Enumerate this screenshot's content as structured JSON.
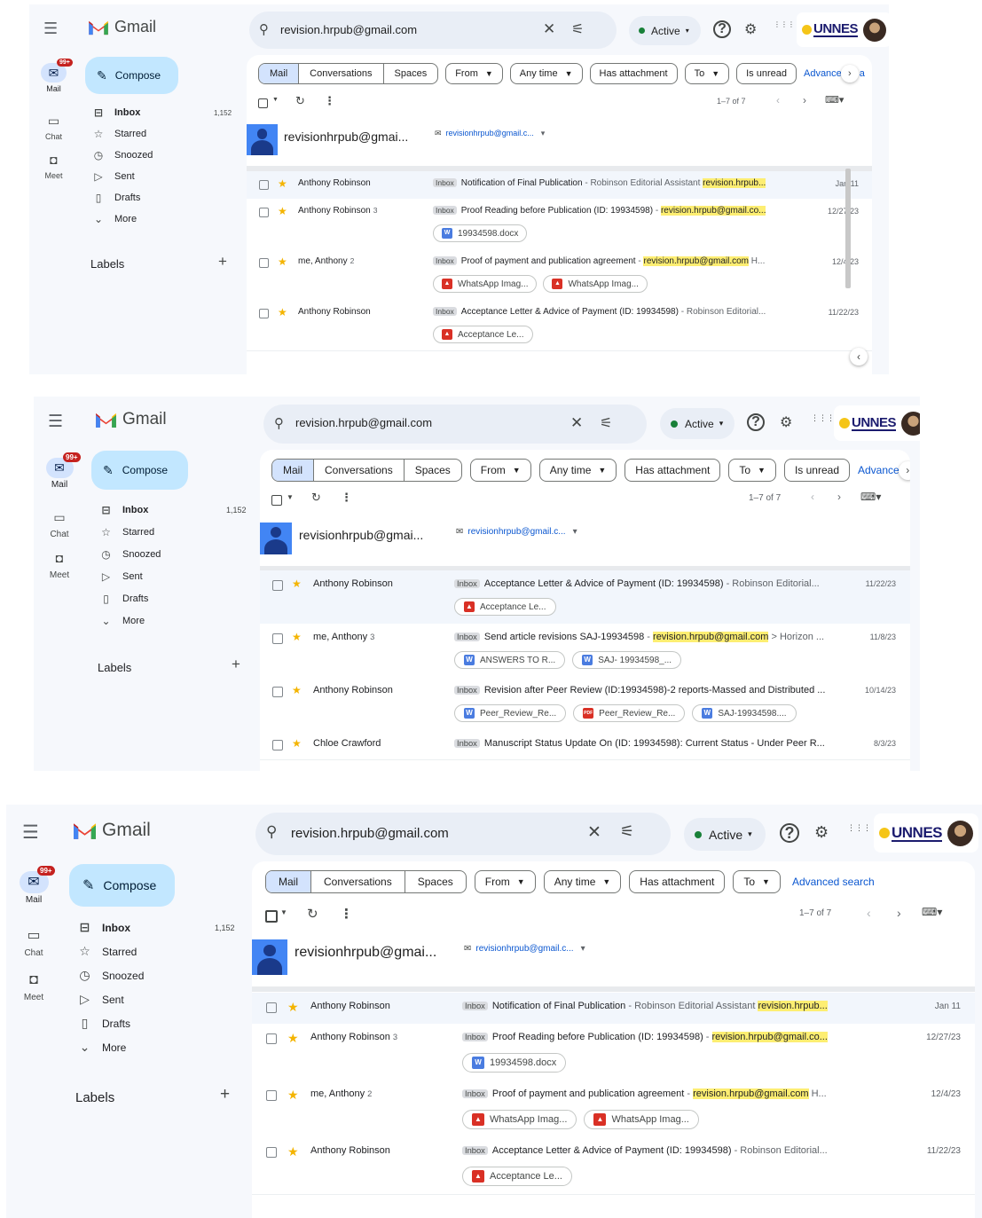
{
  "app": {
    "name": "Gmail"
  },
  "search": {
    "query": "revision.hrpub@gmail.com"
  },
  "status": {
    "label": "Active"
  },
  "brand": {
    "text": "UNNES"
  },
  "rail": {
    "mail": "Mail",
    "mail_badge": "99+",
    "chat": "Chat",
    "meet": "Meet"
  },
  "compose": "Compose",
  "nav": [
    {
      "label": "Inbox",
      "count": "1,152"
    },
    {
      "label": "Starred"
    },
    {
      "label": "Snoozed"
    },
    {
      "label": "Sent"
    },
    {
      "label": "Drafts"
    },
    {
      "label": "More"
    }
  ],
  "labels_heading": "Labels",
  "chips": {
    "mail": "Mail",
    "conversations": "Conversations",
    "spaces": "Spaces",
    "from": "From",
    "any_time": "Any time",
    "has_attachment": "Has attachment",
    "to": "To",
    "is_unread": "Is unread",
    "advance": "Advance",
    "advanced_search": "Advanced search",
    "trail": "a"
  },
  "toolbar": {
    "range": "1–7 of 7"
  },
  "account": {
    "name": "revisionhrpub@gmai...",
    "email": "revisionhrpub@gmail.c..."
  },
  "inbox_tag": "Inbox",
  "emails": [
    {
      "sender": "Anthony Robinson",
      "subject": "Notification of Final Publication",
      "dash": " - ",
      "preview": "Robinson Editorial Assistant ",
      "highlight": "revision.hrpub...",
      "date": "Jan 11"
    },
    {
      "sender": "Anthony Robinson",
      "sender_count": "3",
      "subject": "Proof Reading before Publication (ID: 19934598)",
      "dash": " - ",
      "preview": "",
      "highlight": "revision.hrpub@gmail.co...",
      "date": "12/27/23",
      "attachments": [
        {
          "type": "word",
          "name": "19934598.docx"
        }
      ]
    },
    {
      "sender": "me, Anthony",
      "sender_count": "2",
      "subject": "Proof of payment and publication agreement",
      "dash": " - ",
      "preview": "",
      "highlight": "revision.hrpub@gmail.com",
      "tail": " H...",
      "date": "12/4/23",
      "attachments": [
        {
          "type": "image",
          "name": "WhatsApp Imag..."
        },
        {
          "type": "image",
          "name": "WhatsApp Imag..."
        }
      ]
    },
    {
      "sender": "Anthony Robinson",
      "subject": "Acceptance Letter & Advice of Payment   (ID: 19934598)",
      "dash": " - ",
      "preview": "Robinson Editorial...",
      "date": "11/22/23",
      "attachments": [
        {
          "type": "image",
          "name": "Acceptance Le..."
        }
      ]
    },
    {
      "sender": "me, Anthony",
      "sender_count": "3",
      "subject": "Send article revisions SAJ-19934598",
      "dash": " - ",
      "preview": "",
      "highlight": "revision.hrpub@gmail.com",
      "tail": " > Horizon ...",
      "date": "11/8/23",
      "attachments": [
        {
          "type": "word",
          "name": "ANSWERS TO R..."
        },
        {
          "type": "word",
          "name": "SAJ- 19934598_..."
        }
      ]
    },
    {
      "sender": "Anthony Robinson",
      "subject": "Revision after Peer Review (ID:19934598)-2 reports-Massed and Distributed ...",
      "dash": "",
      "preview": "",
      "date": "10/14/23",
      "attachments": [
        {
          "type": "word",
          "name": "Peer_Review_Re..."
        },
        {
          "type": "pdf",
          "name": "Peer_Review_Re..."
        },
        {
          "type": "word",
          "name": "SAJ-19934598...."
        }
      ]
    },
    {
      "sender": "Chloe Crawford",
      "subject": "Manuscript Status Update On (ID: 19934598): Current Status - Under Peer R...",
      "dash": "",
      "preview": "",
      "date": "8/3/23"
    }
  ]
}
